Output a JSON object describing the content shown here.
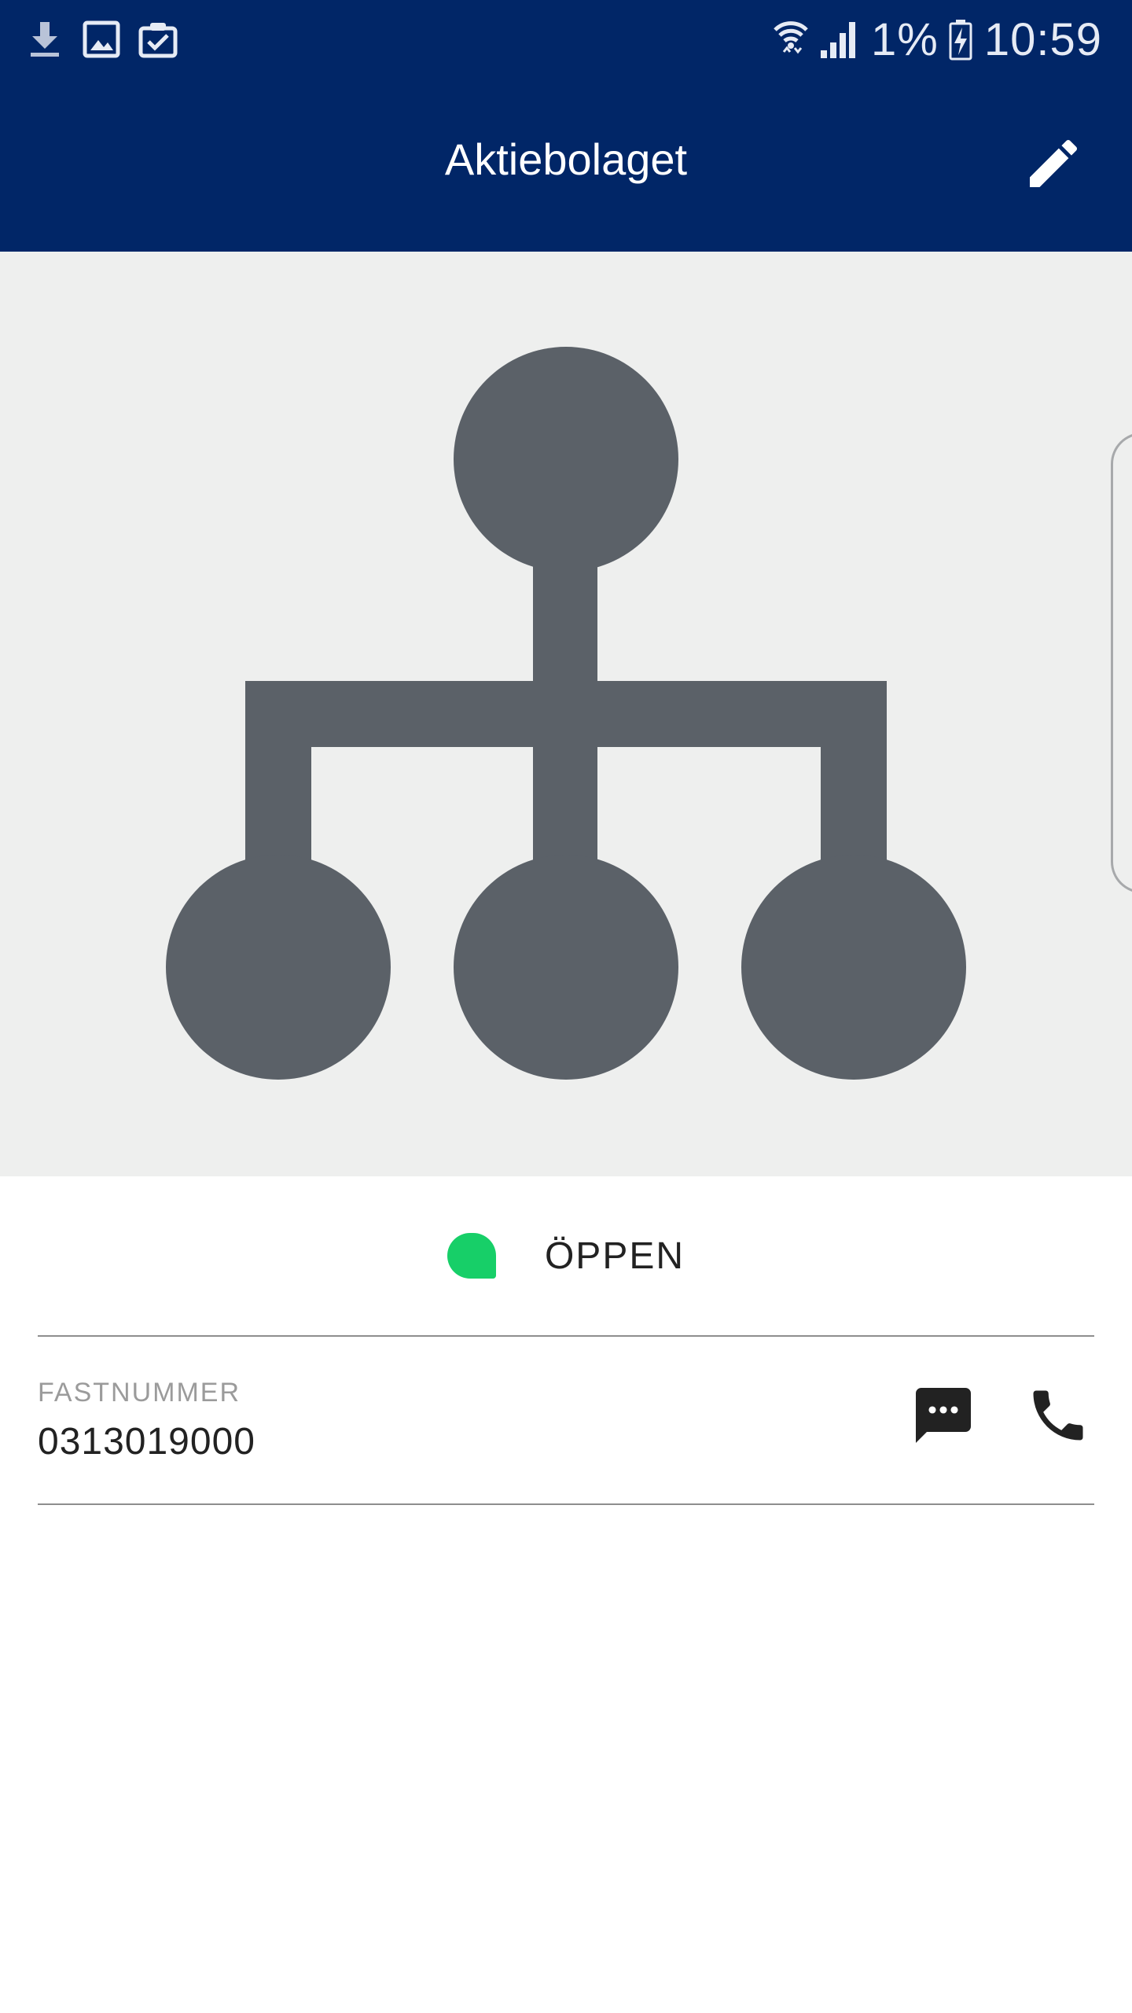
{
  "status_bar": {
    "left_icons": [
      "download-icon",
      "image-icon",
      "clipboard-check-icon"
    ],
    "right_icons": [
      "wifi-icon",
      "signal-icon",
      "battery-charging-icon"
    ],
    "battery_text": "1%",
    "time": "10:59"
  },
  "app_bar": {
    "title": "Aktiebolaget",
    "edit_icon": "pencil-icon"
  },
  "hero": {
    "icon": "org-chart-icon",
    "icon_color": "#5b6168",
    "background": "#eeefee"
  },
  "status": {
    "label": "ÖPPEN",
    "color": "#17cf68"
  },
  "contact": {
    "label": "FASTNUMMER",
    "number": "0313019000",
    "message_icon": "message-icon",
    "call_icon": "phone-icon"
  },
  "colors": {
    "primary": "#012667",
    "text": "#222222",
    "muted": "#9b9b9b"
  }
}
